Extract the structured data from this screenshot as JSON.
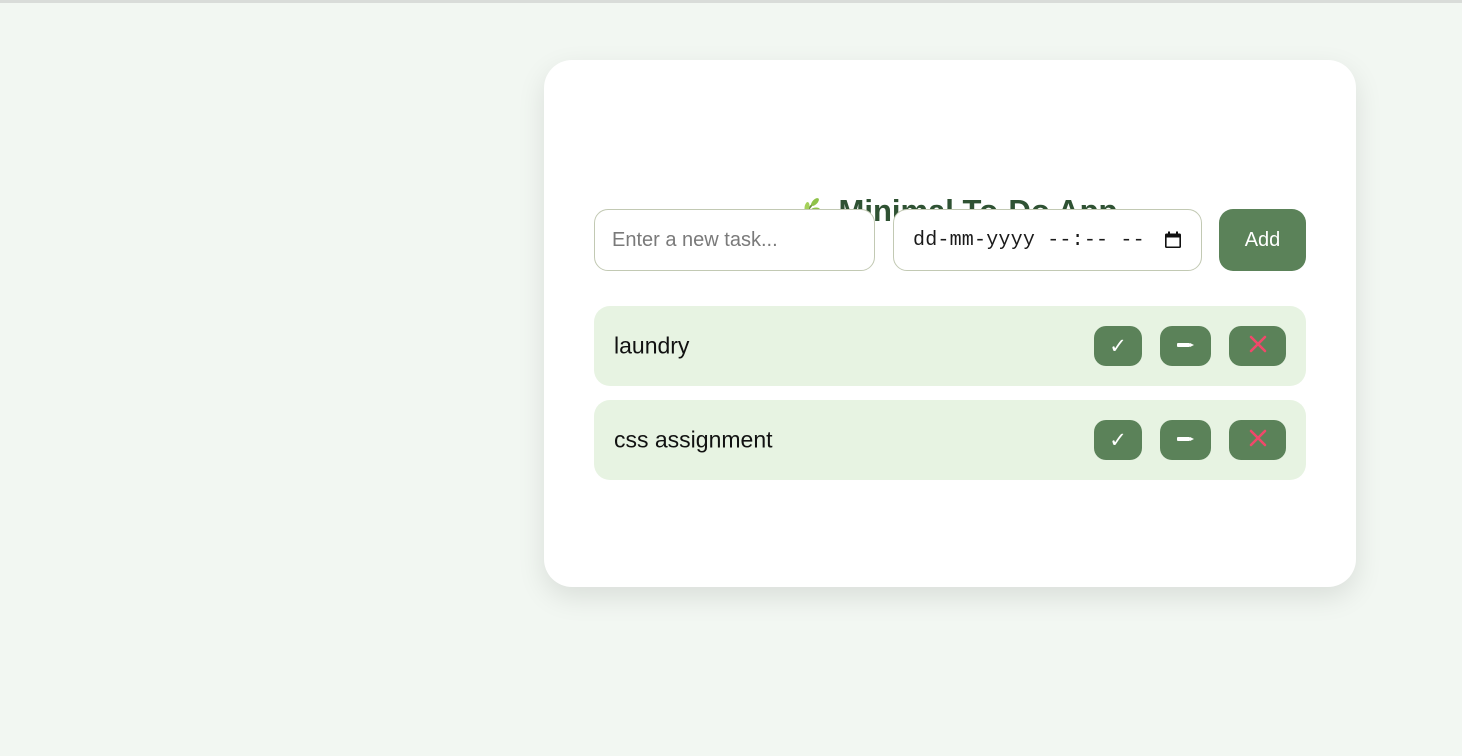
{
  "app": {
    "title": "Minimal To-Do App",
    "title_icon": "leaf-icon"
  },
  "form": {
    "task_placeholder": "Enter a new task...",
    "task_value": "",
    "date_placeholder": "dd-mm-yyyy --:-- --",
    "add_label": "Add"
  },
  "tasks": [
    {
      "label": "laundry",
      "complete_glyph": "✓"
    },
    {
      "label": "css assignment",
      "complete_glyph": "✓"
    }
  ],
  "icons": {
    "complete": "check-icon",
    "edit": "pencil-icon",
    "delete": "cross-mark-icon",
    "date": "calendar-icon"
  },
  "colors": {
    "background": "#f2f7f2",
    "card": "#ffffff",
    "accent": "#5b8259",
    "title": "#2f5233",
    "task_row": "#e7f3e2",
    "delete_cross": "#f0486a"
  }
}
